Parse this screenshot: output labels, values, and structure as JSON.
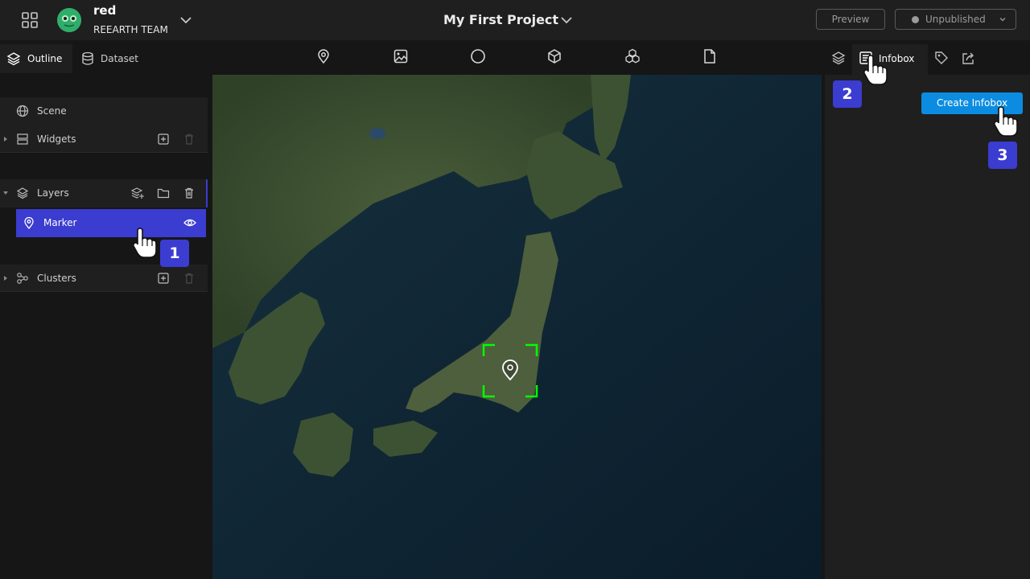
{
  "header": {
    "user_name": "red",
    "team_name": "REEARTH TEAM",
    "project_title": "My First Project",
    "preview_label": "Preview",
    "publish_status": "Unpublished"
  },
  "left_tabs": {
    "outline": "Outline",
    "dataset": "Dataset"
  },
  "tools": [
    "pin-icon",
    "image-icon",
    "circle-icon",
    "box-icon",
    "cubes-icon",
    "file-icon"
  ],
  "right_tabs": {
    "active_label": "Infobox",
    "icons": [
      "layers-icon",
      "infobox-icon",
      "tag-icon",
      "export-icon"
    ]
  },
  "outline": {
    "scene": "Scene",
    "widgets": "Widgets",
    "layers": "Layers",
    "marker": "Marker",
    "clusters": "Clusters"
  },
  "infobox": {
    "create_label": "Create Infobox"
  },
  "steps": [
    "1",
    "2",
    "3"
  ],
  "colors": {
    "accent": "#3b3cd0",
    "primary_button": "#0c8ce0",
    "selection_frame": "#00ff00",
    "avatar": "#2fae6b"
  }
}
